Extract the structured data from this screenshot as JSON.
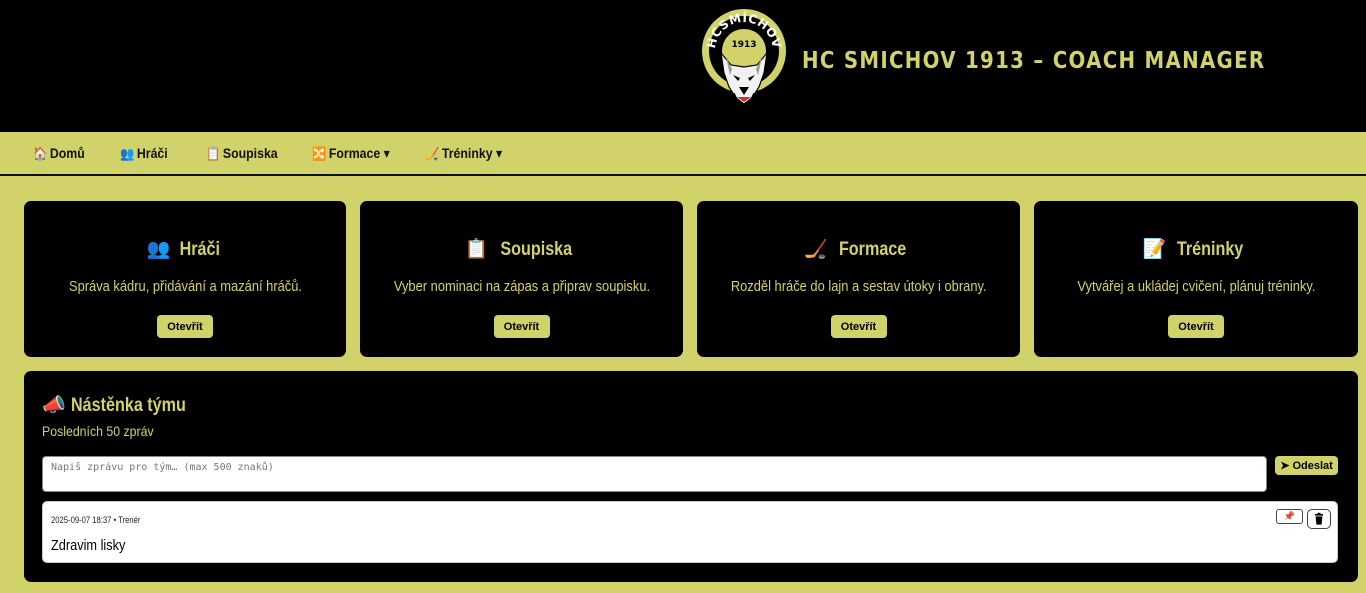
{
  "header": {
    "title": "HC SMICHOV 1913 – COACH MANAGER",
    "logo": {
      "ring_text": "HCSMÍCHOV",
      "year": "1913"
    }
  },
  "nav": {
    "items": [
      {
        "icon": "🏠",
        "label": "Domů"
      },
      {
        "icon": "👥",
        "label": "Hráči"
      },
      {
        "icon": "📋",
        "label": "Soupiska"
      },
      {
        "icon": "🔀",
        "label": "Formace ▾"
      },
      {
        "icon": "🏒",
        "label": "Tréninky ▾"
      }
    ]
  },
  "cards": [
    {
      "icon": "👥",
      "title": "Hráči",
      "desc": "Správa kádru, přidávání a mazání hráčů.",
      "button": "Otevřít"
    },
    {
      "icon": "📋",
      "title": "Soupiska",
      "desc": "Vyber nominaci na zápas a připrav soupisku.",
      "button": "Otevřít"
    },
    {
      "icon": "🏒",
      "title": "Formace",
      "desc": "Rozděl hráče do lajn a sestav útoky i obrany.",
      "button": "Otevřít"
    },
    {
      "icon": "📝",
      "title": "Tréninky",
      "desc": "Vytvářej a ukládej cvičení, plánuj tréninky.",
      "button": "Otevřít"
    }
  ],
  "board": {
    "icon": "📣",
    "title": "Nástěnka týmu",
    "subtitle": "Posledních 50 zpráv",
    "input_placeholder": "Napiš zprávu pro tým… (max 500 znaků)",
    "send_label": "➤ Odeslat",
    "messages": [
      {
        "meta": "2025-09-07 18:37 • Trenér",
        "text": "Zdravim lisky",
        "pin_icon": "📌",
        "delete_icon": "trash-icon"
      }
    ]
  },
  "colors": {
    "accent": "#d2d26a",
    "dark": "#000000",
    "panel": "#ffffff"
  }
}
